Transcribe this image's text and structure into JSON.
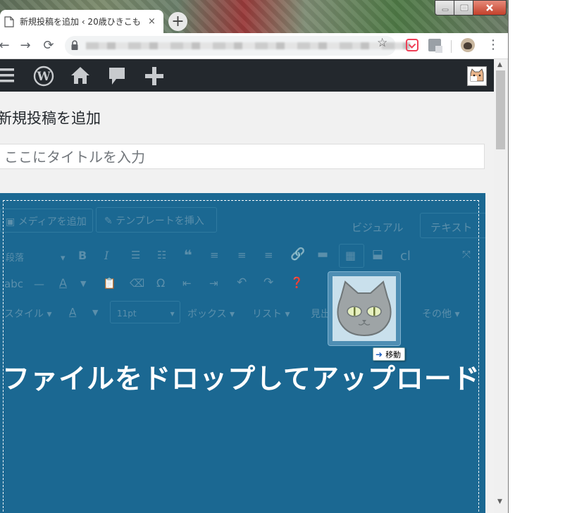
{
  "browser": {
    "tab_title": "新規投稿を追加 ‹ 20歳ひきこも",
    "tab_close": "×",
    "new_tab": "+",
    "nav": {
      "back": "←",
      "forward": "→",
      "reload": "⟳"
    },
    "star": "☆",
    "menu": "⋮"
  },
  "page": {
    "heading": "新規投稿を追加",
    "title_placeholder": "ここにタイトルを入力"
  },
  "editor": {
    "add_media": "メディアを追加",
    "insert_template": "テンプレートを挿入",
    "tab_visual": "ビジュアル",
    "tab_text": "テキスト",
    "paragraph_select": "段落",
    "font_size": "11pt",
    "style_menu": "スタイル",
    "box_menu": "ボックス",
    "list_menu": "リスト",
    "heading_menu": "見出",
    "other_menu": "その他",
    "cl_label": "cl",
    "drop_message": "ファイルをドロップしてアップロード"
  },
  "drag": {
    "action_label": "移動"
  },
  "colors": {
    "admin_bar": "#23282d",
    "drop_overlay": "#1b6892"
  }
}
